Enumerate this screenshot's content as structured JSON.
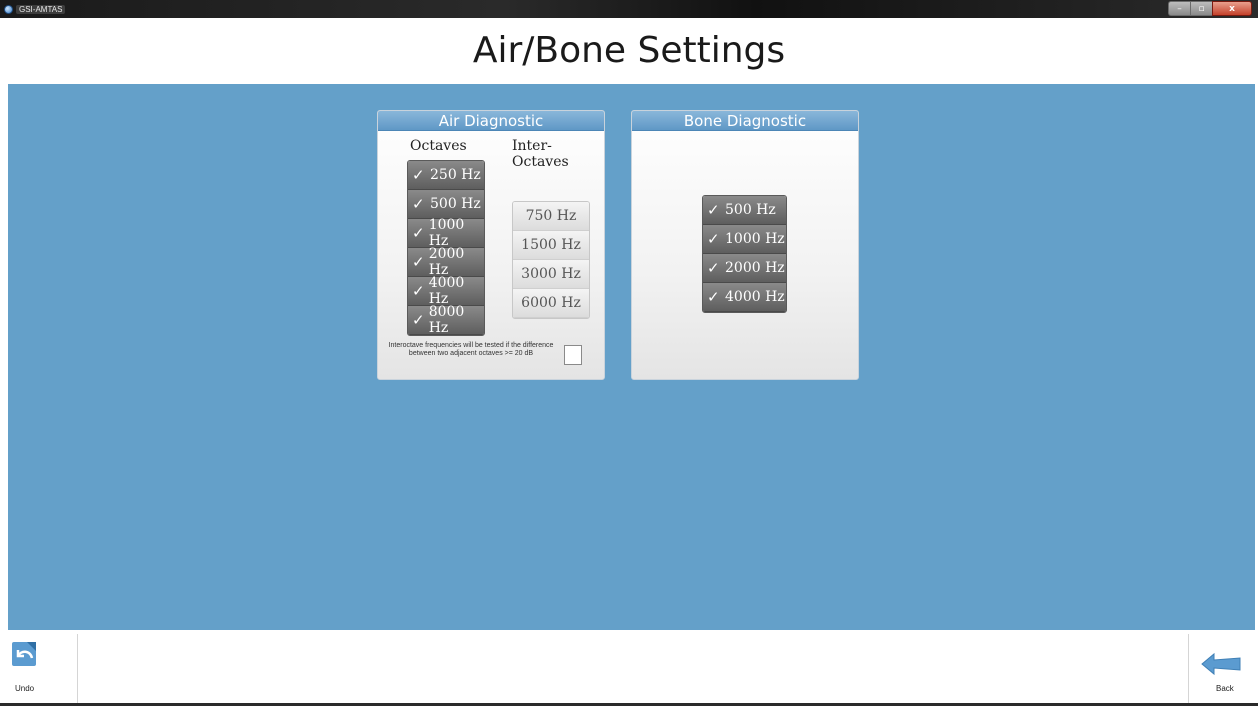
{
  "window": {
    "app_name": "GSI-AMTAS",
    "controls": {
      "minimize": "–",
      "maximize": "▫",
      "close": "x"
    }
  },
  "header": {
    "title": "Air/Bone Settings"
  },
  "air_panel": {
    "title": "Air Diagnostic",
    "octaves_label": "Octaves",
    "inter_octaves_label": "Inter-Octaves",
    "octaves": [
      {
        "label": "250 Hz",
        "checked": true
      },
      {
        "label": "500 Hz",
        "checked": true
      },
      {
        "label": "1000 Hz",
        "checked": true
      },
      {
        "label": "2000 Hz",
        "checked": true
      },
      {
        "label": "4000 Hz",
        "checked": true
      },
      {
        "label": "8000 Hz",
        "checked": true
      }
    ],
    "inter_octaves": [
      {
        "label": "750 Hz",
        "checked": false
      },
      {
        "label": "1500 Hz",
        "checked": false
      },
      {
        "label": "3000 Hz",
        "checked": false
      },
      {
        "label": "6000 Hz",
        "checked": false
      }
    ],
    "interoctave_note": "Interoctave frequencies will be tested if the difference between two adjacent octaves >= 20 dB",
    "interoctave_checkbox_checked": false
  },
  "bone_panel": {
    "title": "Bone Diagnostic",
    "frequencies": [
      {
        "label": "500 Hz",
        "checked": true
      },
      {
        "label": "1000 Hz",
        "checked": true
      },
      {
        "label": "2000 Hz",
        "checked": true
      },
      {
        "label": "4000 Hz",
        "checked": true
      }
    ]
  },
  "footer": {
    "undo_label": "Undo",
    "back_label": "Back"
  },
  "colors": {
    "main_background": "#64a0c9",
    "panel_header": "#5f98c6",
    "selected_button": "#6e6e6e",
    "unselected_button": "#e6e6e6"
  },
  "check_glyph": "✓"
}
